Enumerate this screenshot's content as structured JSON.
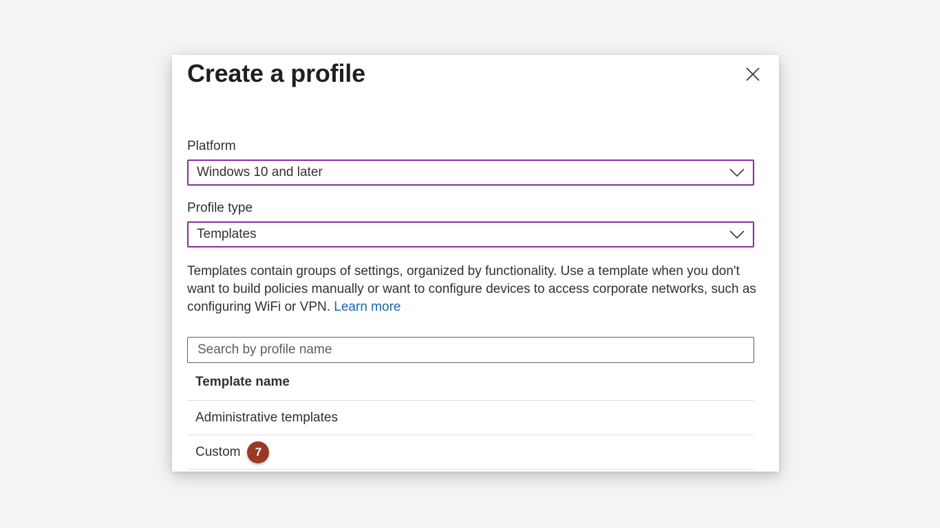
{
  "dialog": {
    "title": "Create a profile",
    "close_icon": "close-icon"
  },
  "platform": {
    "label": "Platform",
    "value": "Windows 10 and later"
  },
  "profile_type": {
    "label": "Profile type",
    "value": "Templates"
  },
  "description": {
    "text": "Templates contain groups of settings, organized by functionality. Use a template when you don't want to build policies manually or want to configure devices to access corporate networks, such as configuring WiFi or VPN.",
    "link": "Learn more"
  },
  "search": {
    "placeholder": "Search by profile name",
    "value": ""
  },
  "table": {
    "header": "Template name",
    "rows": [
      {
        "name": "Administrative templates"
      },
      {
        "name": "Custom",
        "badge": "7"
      }
    ]
  },
  "colors": {
    "select_border": "#8a2da5",
    "link": "#0f6cbd",
    "badge": "#9a3a23"
  }
}
